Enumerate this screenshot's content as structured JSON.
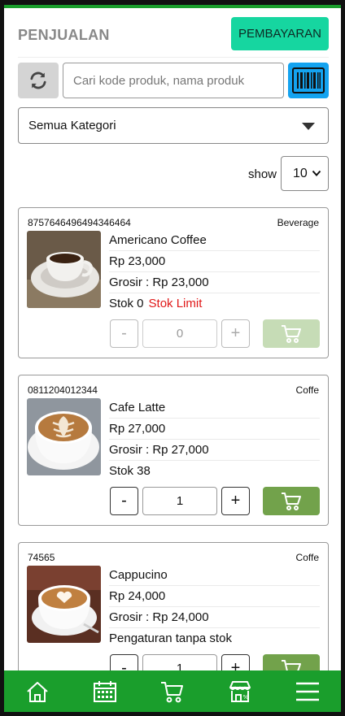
{
  "header": {
    "title": "PENJUALAN",
    "payment_button": "PEMBAYARAN"
  },
  "search": {
    "placeholder": "Cari kode produk, nama produk",
    "value": ""
  },
  "category_filter": {
    "selected": "Semua Kategori"
  },
  "pagination": {
    "show_label": "show",
    "page_size": "10"
  },
  "products": [
    {
      "code": "8757646496494346464",
      "category": "Beverage",
      "name": "Americano Coffee",
      "price": "Rp 23,000",
      "wholesale": "Grosir : Rp 23,000",
      "stock": "Stok 0",
      "stock_flag": "Stok Limit",
      "quantity": "0",
      "minus": "-",
      "plus": "+"
    },
    {
      "code": "0811204012344",
      "category": "Coffe",
      "name": "Cafe Latte",
      "price": "Rp 27,000",
      "wholesale": "Grosir : Rp 27,000",
      "stock": "Stok 38",
      "quantity": "1",
      "minus": "-",
      "plus": "+"
    },
    {
      "code": "74565",
      "category": "Coffe",
      "name": "Cappucino",
      "price": "Rp 24,000",
      "wholesale": "Grosir : Rp 24,000",
      "stock": "Pengaturan tanpa stok",
      "quantity": "1",
      "minus": "-",
      "plus": "+"
    }
  ],
  "bottom_nav": [
    {
      "icon": "home-icon"
    },
    {
      "icon": "calendar-icon"
    },
    {
      "icon": "cart-icon"
    },
    {
      "icon": "store-icon"
    },
    {
      "icon": "menu-icon"
    }
  ],
  "colors": {
    "brand_green": "#1a9e2c",
    "pay_button": "#16d6a0",
    "barcode_button": "#14a3f0",
    "cart_button": "#72a24b",
    "stock_limit": "#e01818"
  }
}
